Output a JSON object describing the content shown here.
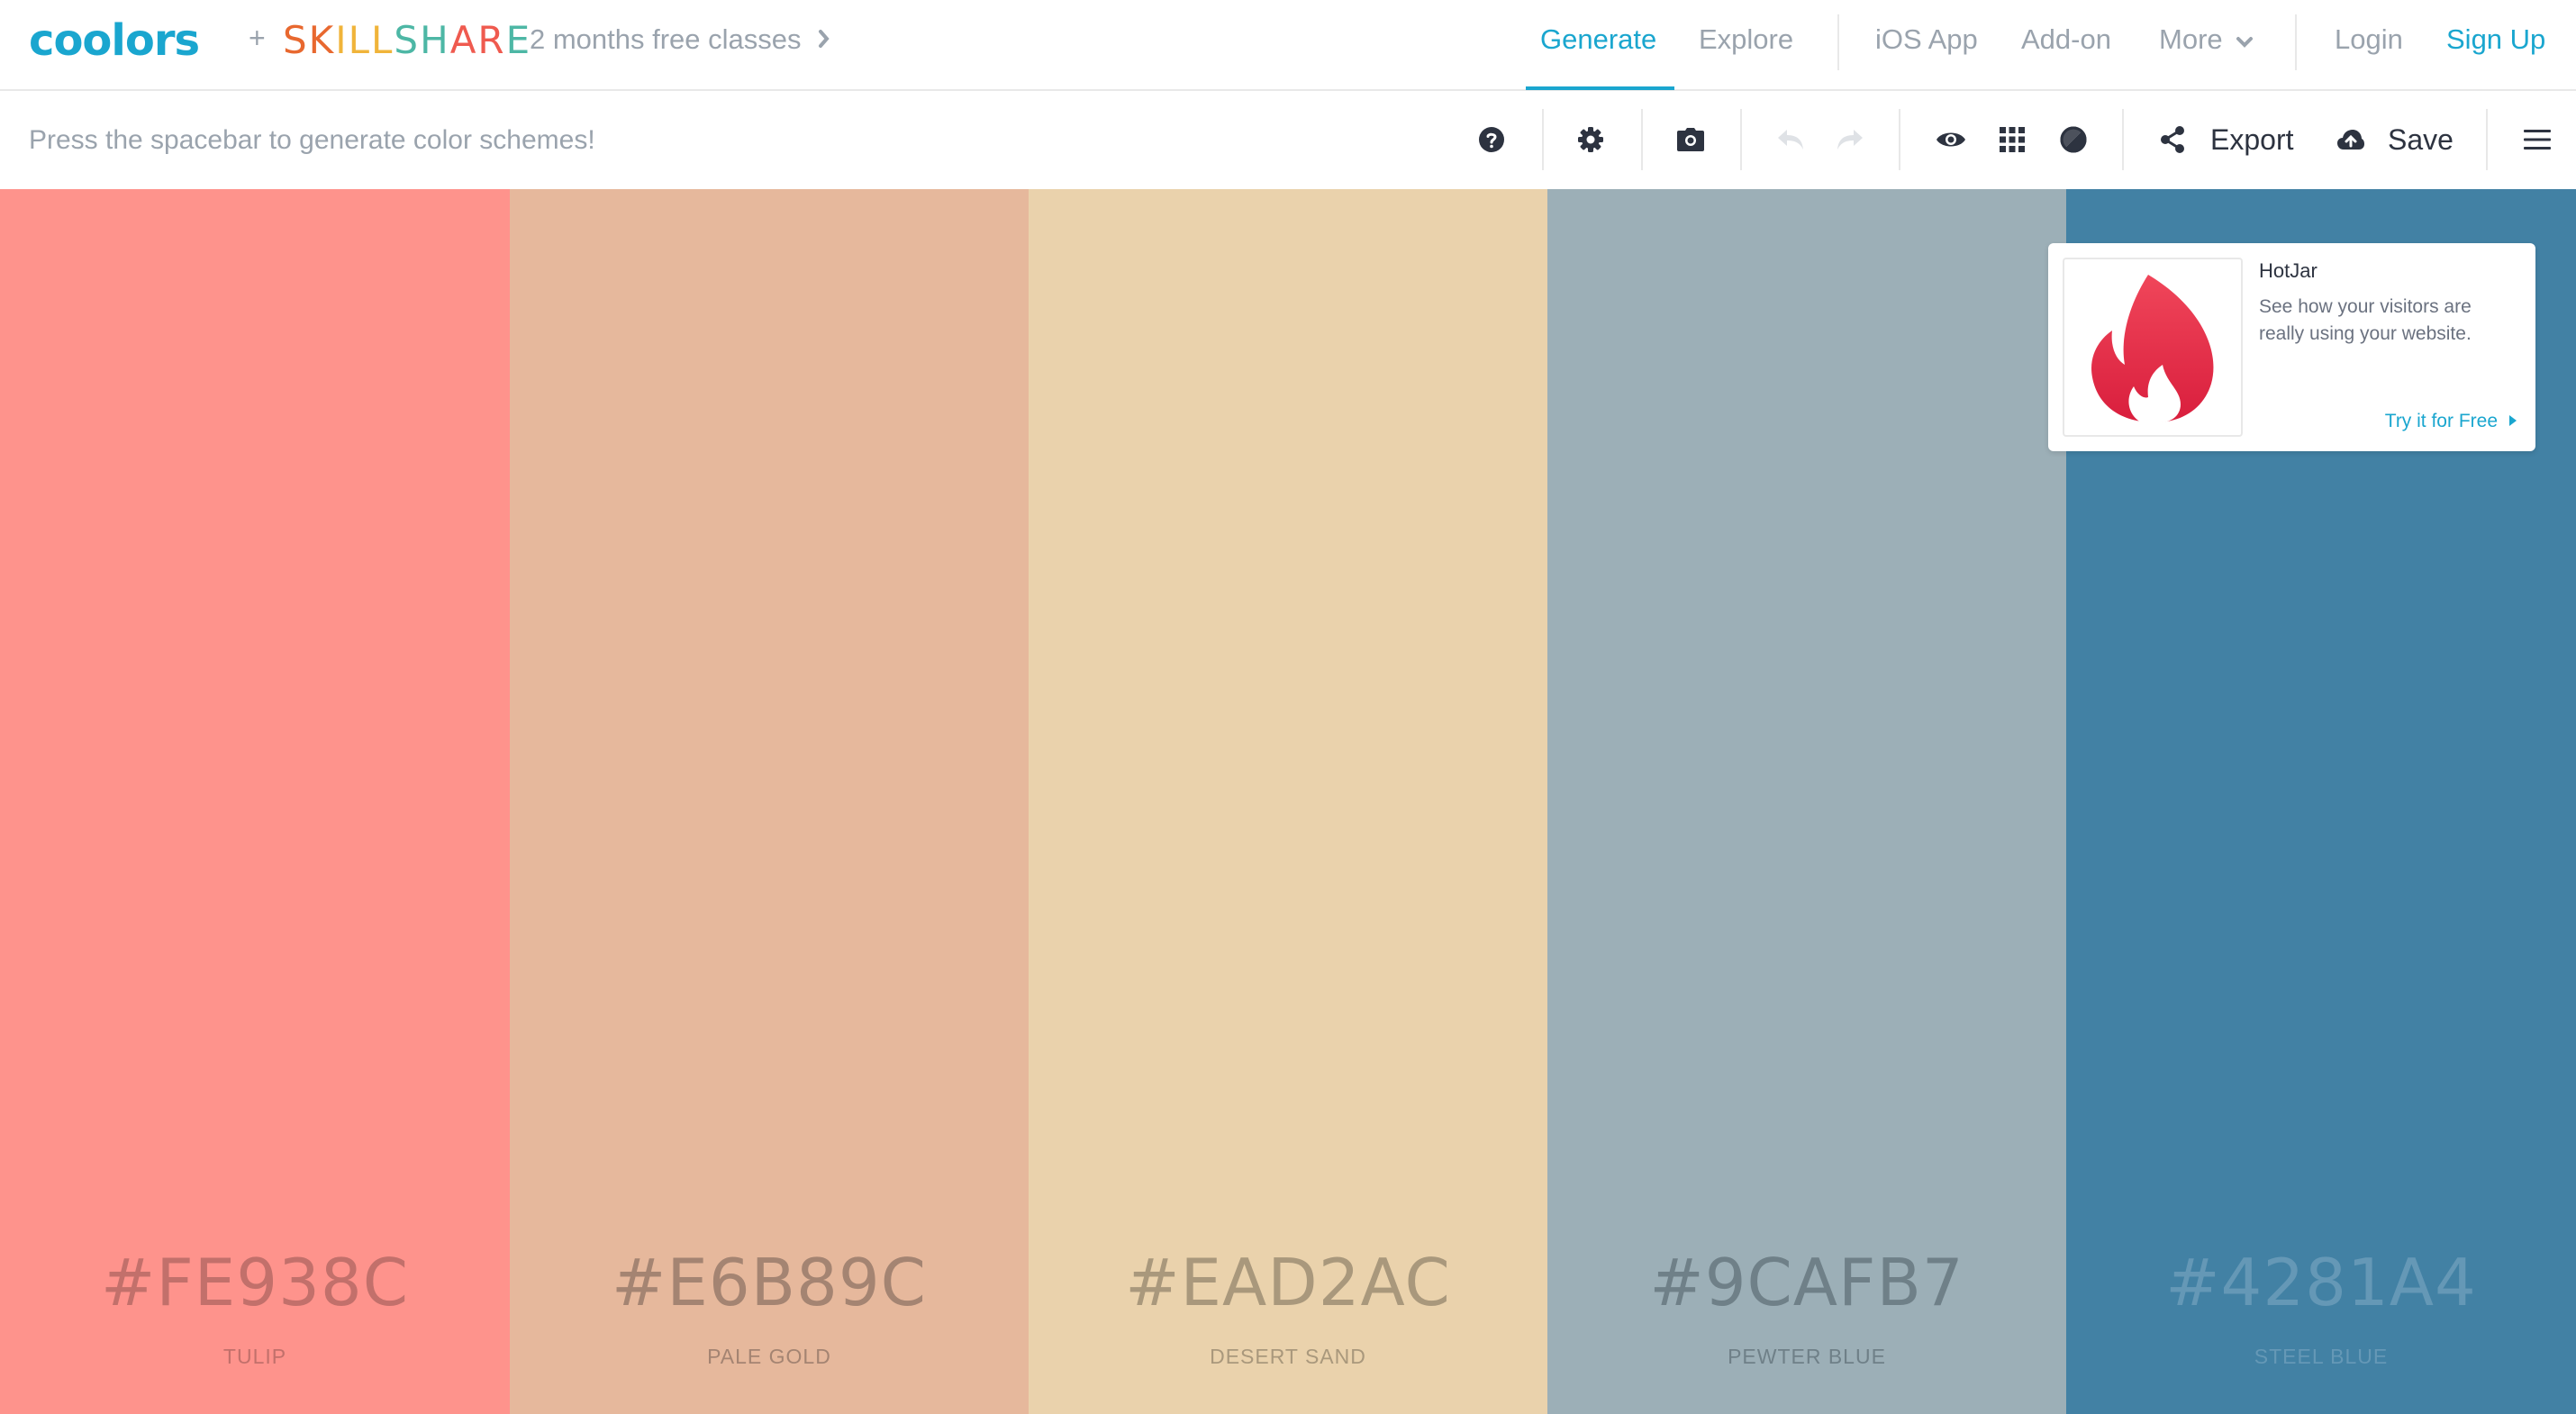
{
  "brand": {
    "logo": "coolors",
    "plus": "+",
    "partner": "SKILLSHARE",
    "partner_colors": [
      "#e8682f",
      "#f0b43a",
      "#4db7a5",
      "#ef5a4f"
    ],
    "promo_text": "2 months free classes"
  },
  "nav": {
    "generate": "Generate",
    "explore": "Explore",
    "ios_app": "iOS App",
    "add_on": "Add-on",
    "more": "More",
    "login": "Login",
    "signup": "Sign Up"
  },
  "toolbar": {
    "hint": "Press the spacebar to generate color schemes!",
    "icons": [
      "help-icon",
      "settings-icon",
      "camera-icon",
      "undo-icon",
      "redo-icon",
      "eye-icon",
      "grid-icon",
      "contrast-icon",
      "share-icon",
      "upload-icon",
      "menu-icon"
    ],
    "export_label": "Export",
    "save_label": "Save"
  },
  "colors": {
    "accent": "#1aa6cf",
    "text_muted": "#9aa3ad",
    "text_dark": "#2d3340"
  },
  "palette": [
    {
      "hex": "#FE938C",
      "name": "TULIP",
      "bg": "#FE938C",
      "fg": "#c2706b"
    },
    {
      "hex": "#E6B89C",
      "name": "PALE GOLD",
      "bg": "#E6B89C",
      "fg": "#a48472"
    },
    {
      "hex": "#EAD2AC",
      "name": "DESERT SAND",
      "bg": "#EAD2AC",
      "fg": "#a9987c"
    },
    {
      "hex": "#9CAFB7",
      "name": "PEWTER BLUE",
      "bg": "#9CAFB7",
      "fg": "#6f8088"
    },
    {
      "hex": "#4281A4",
      "name": "STEEL BLUE",
      "bg": "#4281A4",
      "fg": "#6598b6"
    }
  ],
  "ad": {
    "title": "HotJar",
    "text": "See how your visitors are really using your website.",
    "cta": "Try it for Free"
  }
}
